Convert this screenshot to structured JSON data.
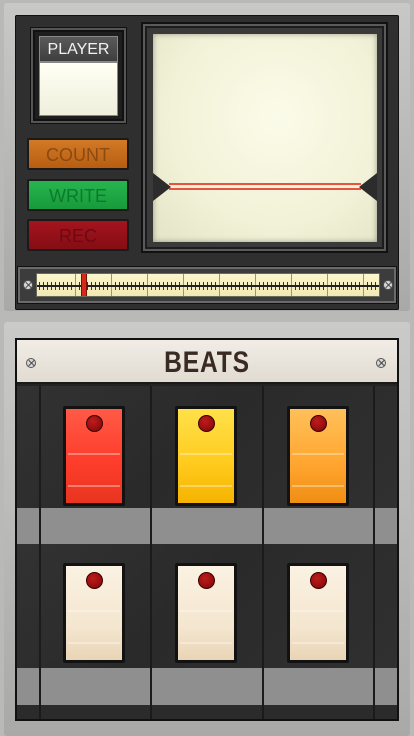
{
  "player": {
    "label": "PLAYER"
  },
  "buttons": {
    "count": "COUNT",
    "write": "WRITE",
    "rec": "REC"
  },
  "display": {
    "trace_color": "#e8533f"
  },
  "position_slider": {
    "value_fraction": 0.13
  },
  "beats": {
    "title": "BEATS",
    "pads": [
      {
        "color": "red",
        "lit": true
      },
      {
        "color": "yellow",
        "lit": true
      },
      {
        "color": "orange",
        "lit": true
      },
      {
        "color": "cream",
        "lit": false
      },
      {
        "color": "cream",
        "lit": false
      },
      {
        "color": "cream",
        "lit": false
      }
    ]
  },
  "colors": {
    "count": "#c96a1c",
    "write": "#1fa846",
    "rec": "#9a111a",
    "pad_red": "#ff3d2c",
    "pad_yellow": "#ffca1c",
    "pad_orange": "#ffa52e",
    "pad_cream": "#f4e6cf"
  }
}
